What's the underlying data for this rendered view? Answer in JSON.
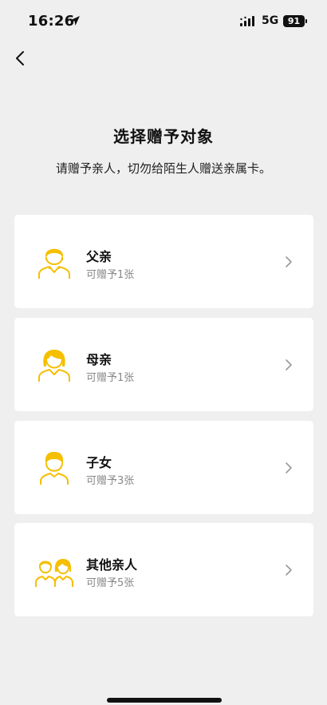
{
  "status_bar": {
    "time": "16:26",
    "network": "5G",
    "battery": "91"
  },
  "header": {
    "title": "选择赠予对象",
    "subtitle": "请赠予亲人，切勿给陌生人赠送亲属卡。"
  },
  "recipients": [
    {
      "name": "父亲",
      "quota": "可赠予1张",
      "icon": "father-icon"
    },
    {
      "name": "母亲",
      "quota": "可赠予1张",
      "icon": "mother-icon"
    },
    {
      "name": "子女",
      "quota": "可赠予3张",
      "icon": "child-icon"
    },
    {
      "name": "其他亲人",
      "quota": "可赠予5张",
      "icon": "other-relatives-icon"
    }
  ],
  "colors": {
    "accent": "#f5bf00",
    "background": "#efefef",
    "card": "#ffffff",
    "muted_text": "#888888"
  }
}
